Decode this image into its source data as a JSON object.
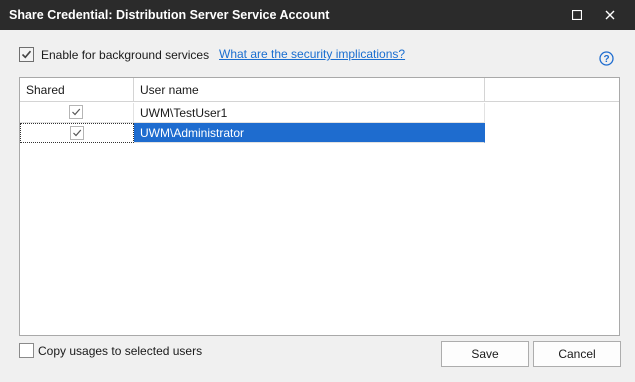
{
  "window": {
    "title": "Share Credential: Distribution Server Service Account",
    "maximize_icon": "maximize-icon",
    "close_icon": "close-icon"
  },
  "options": {
    "enable_background": {
      "label": "Enable for background services",
      "checked": true
    },
    "security_link": "What are the security implications?",
    "help_icon": "help-icon"
  },
  "grid": {
    "columns": [
      "Shared",
      "User name"
    ],
    "rows": [
      {
        "shared": true,
        "user": "UWM\\TestUser1",
        "selected": false
      },
      {
        "shared": true,
        "user": "UWM\\Administrator",
        "selected": true
      }
    ]
  },
  "footer": {
    "copy_usages": {
      "label": "Copy usages to selected users",
      "checked": false
    },
    "save_label": "Save",
    "cancel_label": "Cancel"
  },
  "colors": {
    "titlebar": "#2b2b2b",
    "selection": "#1e6ccf",
    "link": "#1a6ed0"
  }
}
